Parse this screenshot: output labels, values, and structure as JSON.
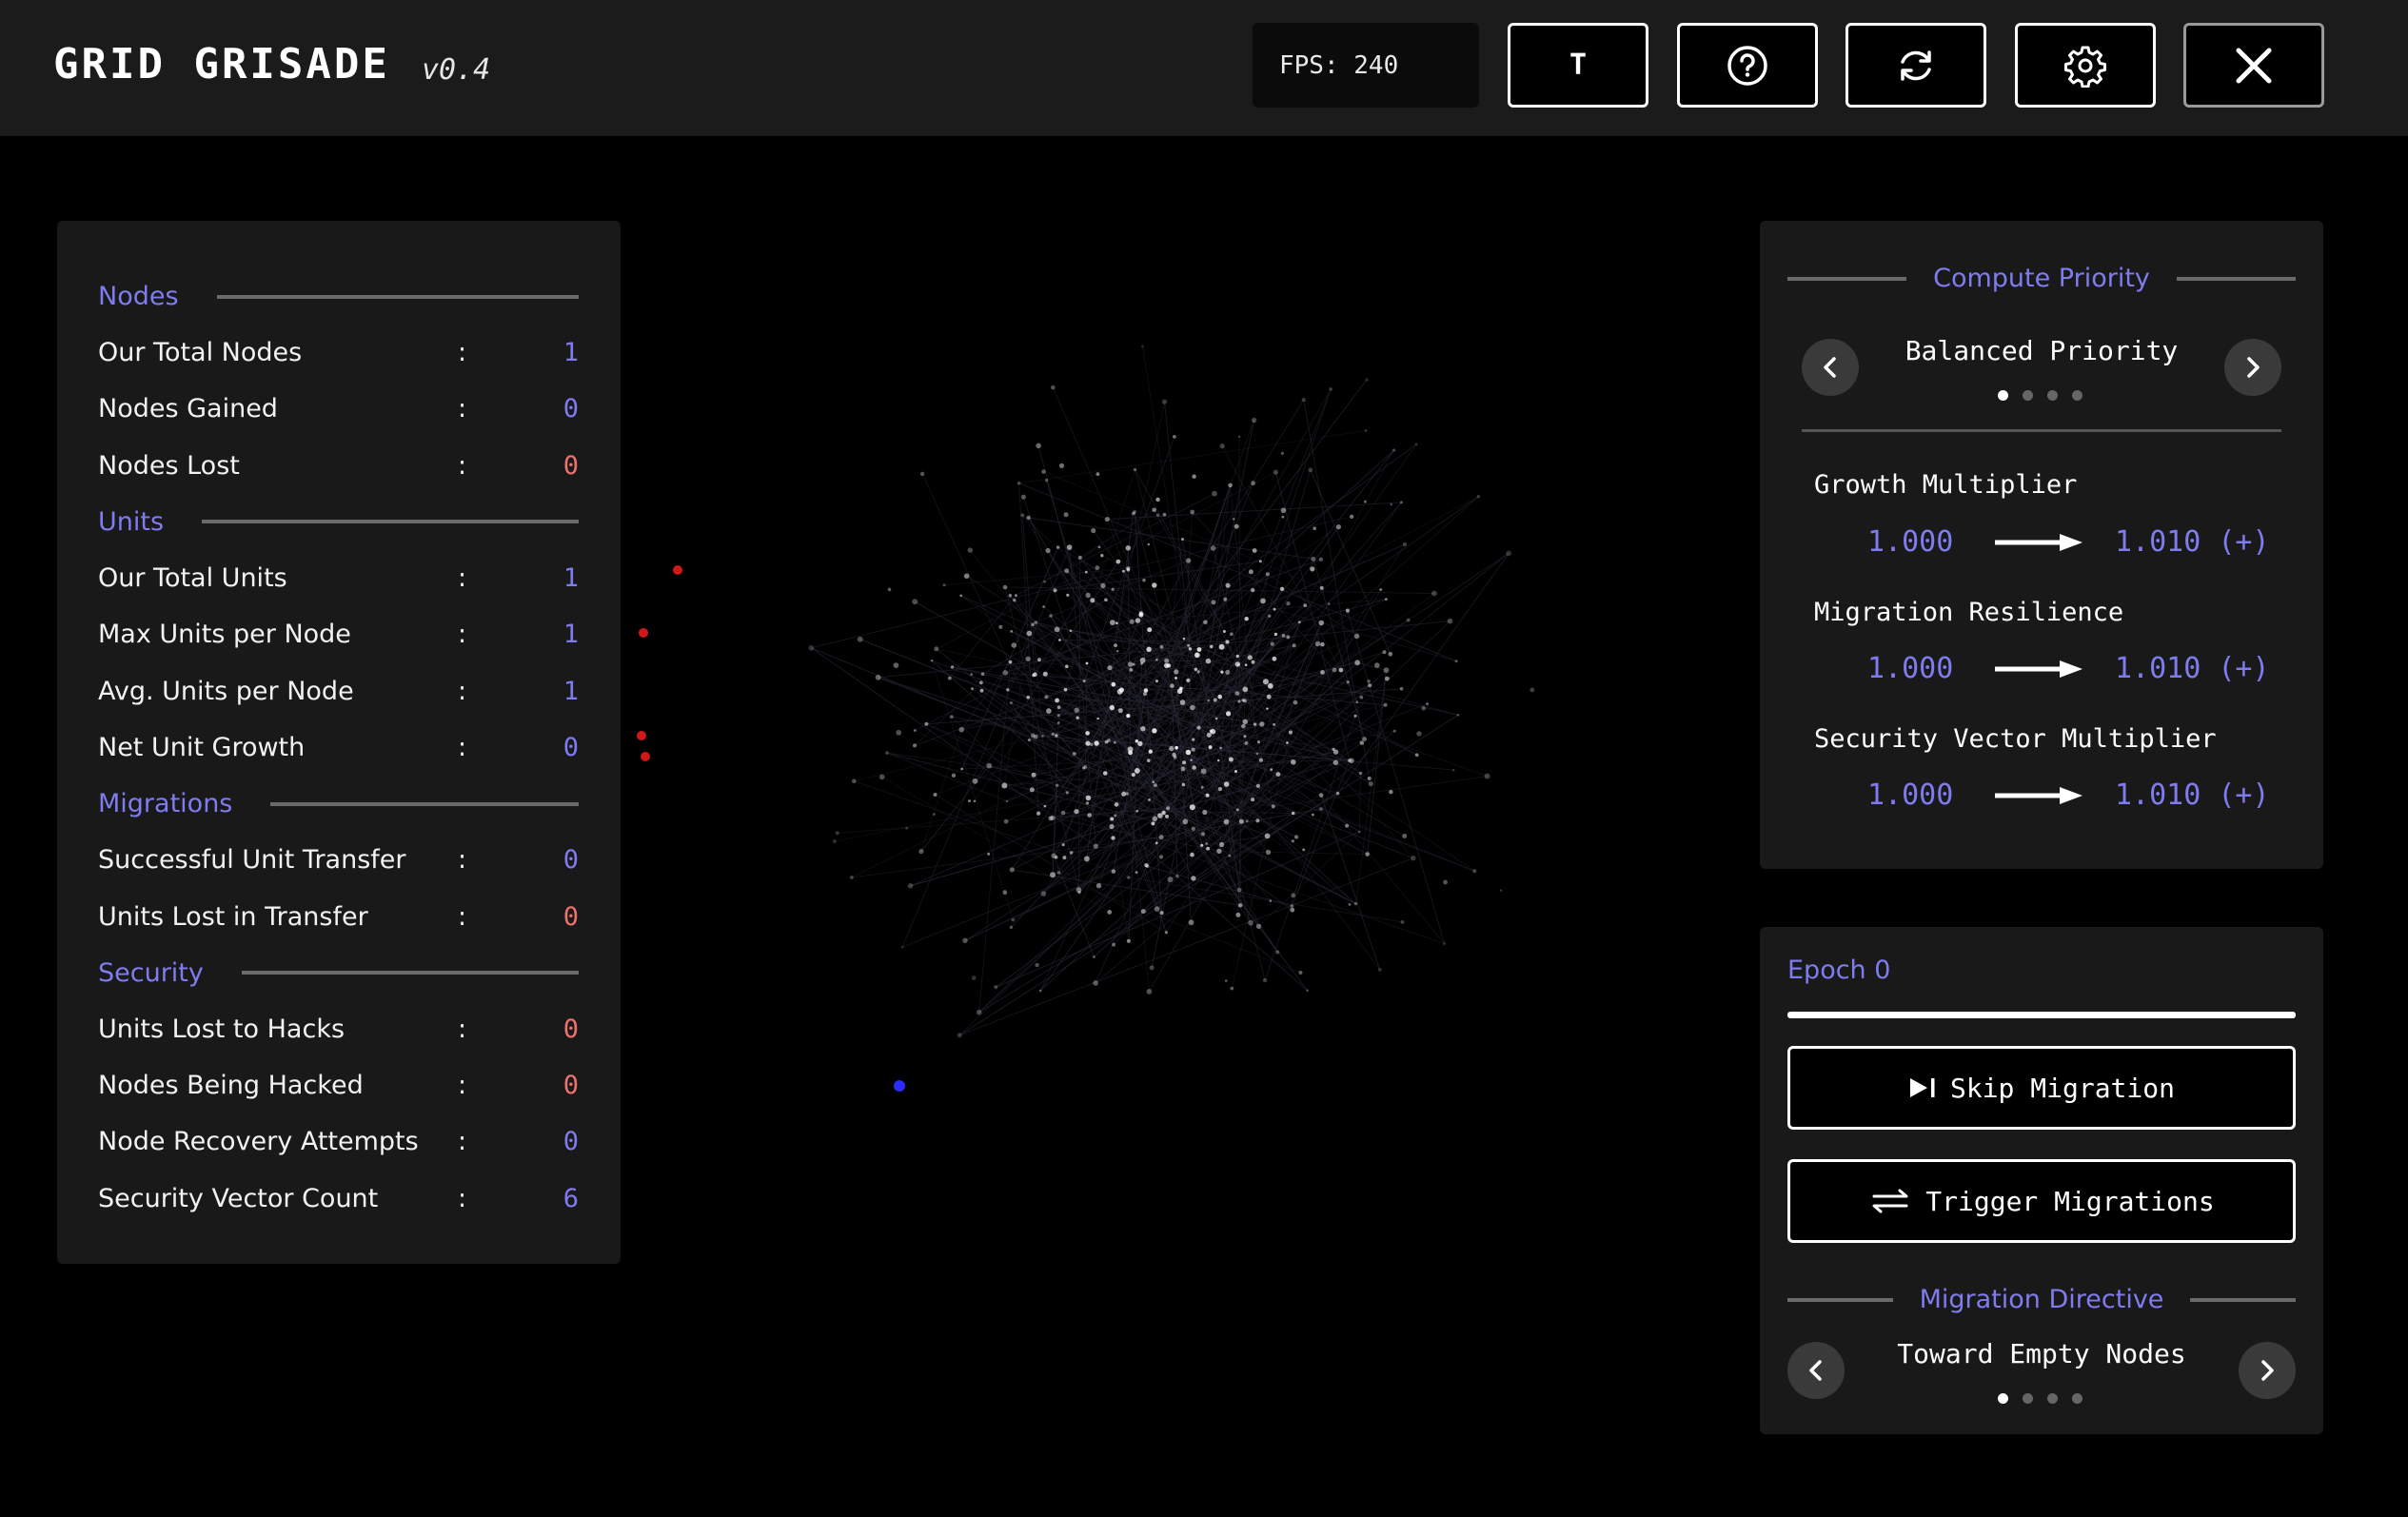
{
  "header": {
    "title": "GRID GRISADE",
    "version": "v0.4",
    "fps": "FPS: 240",
    "t_button": "T",
    "icons": [
      "help-icon",
      "refresh-icon",
      "gear-icon",
      "close-icon"
    ]
  },
  "stats": {
    "sections": [
      {
        "title": "Nodes",
        "rows": [
          {
            "label": "Our Total Nodes",
            "value": "1",
            "color": "blue"
          },
          {
            "label": "Nodes Gained",
            "value": "0",
            "color": "blue"
          },
          {
            "label": "Nodes Lost",
            "value": "0",
            "color": "red"
          }
        ]
      },
      {
        "title": "Units",
        "rows": [
          {
            "label": "Our Total Units",
            "value": "1",
            "color": "blue"
          },
          {
            "label": "Max Units per Node",
            "value": "1",
            "color": "blue"
          },
          {
            "label": "Avg. Units per Node",
            "value": "1",
            "color": "blue"
          },
          {
            "label": "Net Unit Growth",
            "value": "0",
            "color": "blue"
          }
        ]
      },
      {
        "title": "Migrations",
        "rows": [
          {
            "label": "Successful Unit Transfer",
            "value": "0",
            "color": "blue"
          },
          {
            "label": "Units Lost in Transfer",
            "value": "0",
            "color": "red"
          }
        ]
      },
      {
        "title": "Security",
        "rows": [
          {
            "label": "Units Lost to Hacks",
            "value": "0",
            "color": "red"
          },
          {
            "label": "Nodes Being Hacked",
            "value": "0",
            "color": "red"
          },
          {
            "label": "Node Recovery Attempts",
            "value": "0",
            "color": "blue"
          },
          {
            "label": "Security Vector Count",
            "value": "6",
            "color": "blue"
          }
        ]
      }
    ]
  },
  "priority": {
    "title": "Compute Priority",
    "selected": "Balanced Priority",
    "page_count": 4,
    "active_page": 1,
    "multipliers": [
      {
        "label": "Growth Multiplier",
        "from": "1.000",
        "to": "1.010 (+)"
      },
      {
        "label": "Migration Resilience",
        "from": "1.000",
        "to": "1.010 (+)"
      },
      {
        "label": "Security Vector Multiplier",
        "from": "1.000",
        "to": "1.010 (+)"
      }
    ]
  },
  "epoch": {
    "label": "Epoch 0",
    "progress": 1.0,
    "skip_label": "Skip Migration",
    "trigger_label": "Trigger Migrations",
    "directive_title": "Migration Directive",
    "directive_selected": "Toward Empty Nodes",
    "directive_page_count": 4,
    "directive_active_page": 1
  },
  "colors": {
    "accent": "#7f7cf0",
    "danger": "#f07070",
    "panel": "#191919",
    "header": "#1b1b1b",
    "player_node": "#2b2bff",
    "enemy_node": "#d01818"
  }
}
